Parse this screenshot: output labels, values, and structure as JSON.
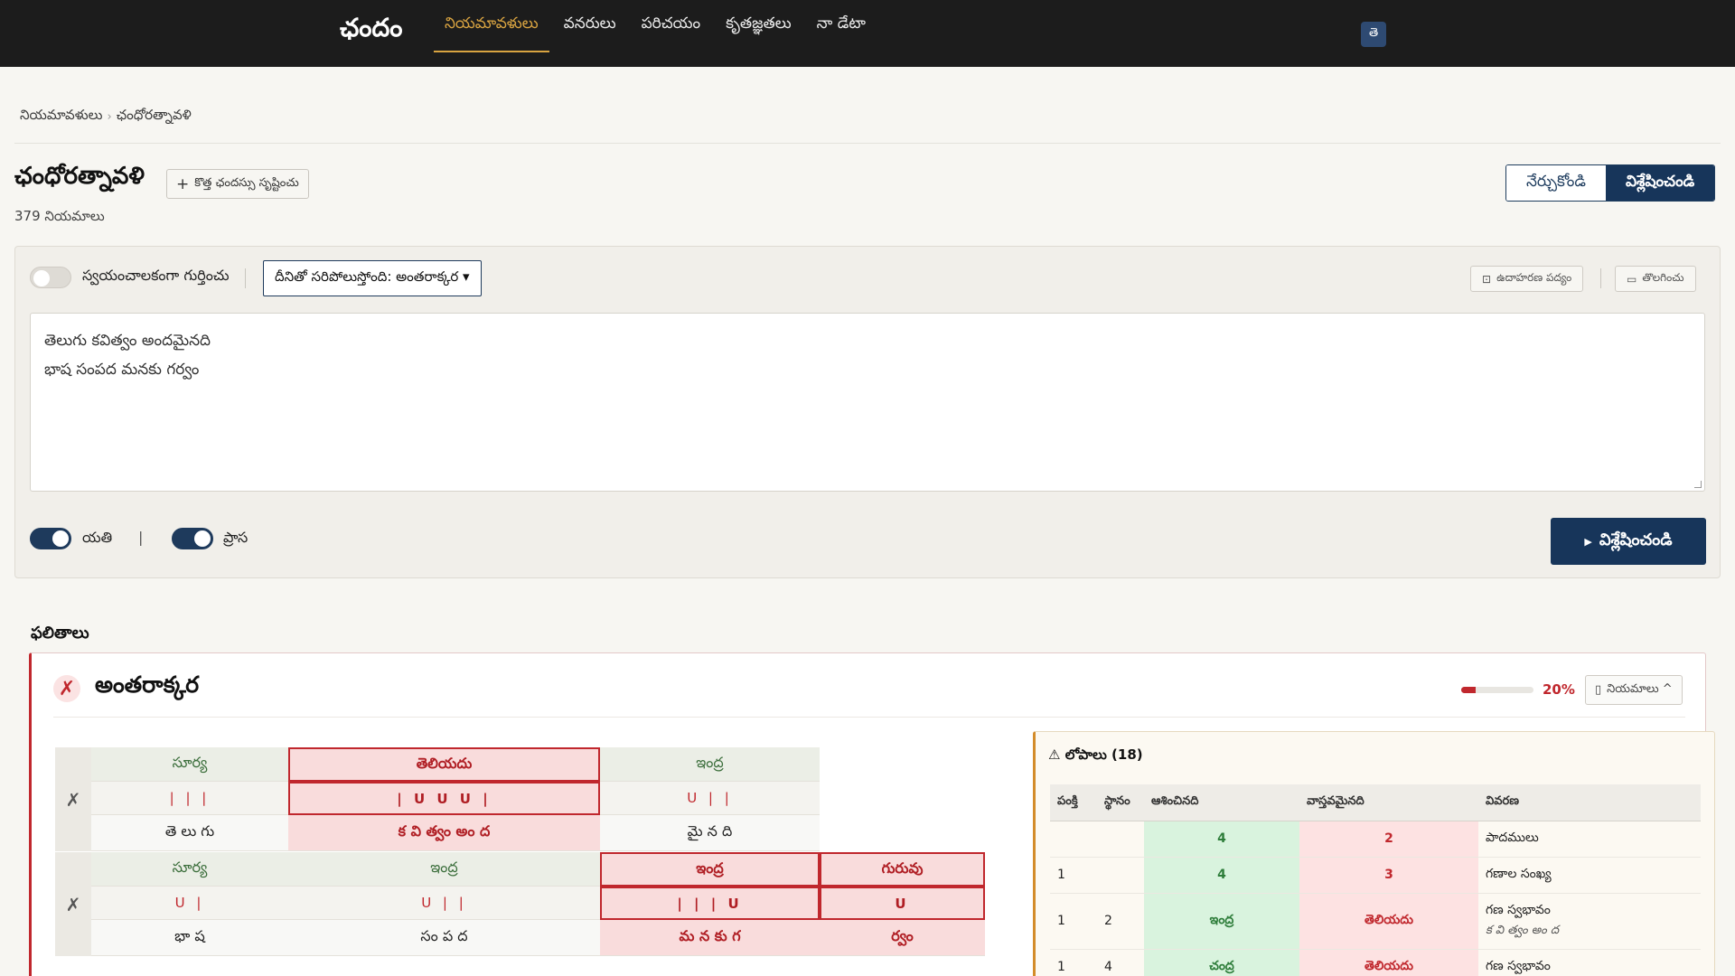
{
  "app": {
    "brand": "ఛందం",
    "lang_button": "తె"
  },
  "nav": [
    {
      "label": "నియమావళులు",
      "active": true
    },
    {
      "label": "వనరులు",
      "active": false
    },
    {
      "label": "పరిచయం",
      "active": false
    },
    {
      "label": "కృతజ్ఞతలు",
      "active": false
    },
    {
      "label": "నా డేటా",
      "active": false
    }
  ],
  "breadcrumb": [
    "నియమావళులు",
    "ఛంధోరత్నావళి"
  ],
  "page": {
    "title": "ఛంధోరత్నావళి",
    "new_button": "కొత్త ఛందస్సు సృష్టించు",
    "count": "379 నియమాలు",
    "mode_learn": "నేర్చుకోండి",
    "mode_analyze": "విశ్లేషించండి"
  },
  "analyzer": {
    "auto_detect_label": "స్వయంచాలకంగా గుర్తించు",
    "auto_detect_on": false,
    "meter_select": "దీనితో సరిపోలుస్తోంది: అంతరాక్కర ▾",
    "example_button": "ఉదాహరణ పద్యం",
    "clear_button": "తొలగించు",
    "poem_lines": [
      "తెలుగు కవిత్వం అందమైనది",
      "భాష సంపద మనకు గర్వం"
    ],
    "yati_label": "యతి",
    "yati_on": true,
    "prasa_label": "ప్రాస",
    "prasa_on": true,
    "analyze_button": "విశ్లేషించండి"
  },
  "results": {
    "heading": "ఫలితాలు",
    "meter_name": "అంతరాక్కర",
    "match_percent": 20,
    "match_label": "20%",
    "rules_button": "నియమాలు ^",
    "status_icon": "cross-icon",
    "rows": [
      {
        "mark": "✗",
        "cells": [
          {
            "gana": "సూర్య",
            "pattern": "| | |",
            "syllables": "తె లు గు",
            "bad": false
          },
          {
            "gana": "తెలియదు",
            "pattern": "| U U U |",
            "syllables": "క వి త్వం అం ద",
            "bad": true
          },
          {
            "gana": "ఇంద్ర",
            "pattern": "U | |",
            "syllables": "మై న ది",
            "bad": false
          }
        ]
      },
      {
        "mark": "✗",
        "cells": [
          {
            "gana": "సూర్య",
            "pattern": "U |",
            "syllables": "భా ష",
            "bad": false
          },
          {
            "gana": "ఇంద్ర",
            "pattern": "U | |",
            "syllables": "సం ప ద",
            "bad": false
          },
          {
            "gana": "ఇంద్ర",
            "pattern": "| | | U",
            "syllables": "మ న కు గ",
            "bad": true
          },
          {
            "gana": "గురువు",
            "pattern": "U",
            "syllables": "ర్వం",
            "bad": true
          }
        ]
      }
    ],
    "errors": {
      "title": "లోపాలు (18)",
      "warning_icon": "warning-icon",
      "columns": [
        "పంక్తి",
        "స్థానం",
        "ఆశించినది",
        "వాస్తవమైనది",
        "వివరణ"
      ],
      "rows": [
        {
          "line": "",
          "pos": "",
          "expected": "4",
          "actual": "2",
          "desc": "పాదములు",
          "sub": ""
        },
        {
          "line": "1",
          "pos": "",
          "expected": "4",
          "actual": "3",
          "desc": "గణాల సంఖ్య",
          "sub": ""
        },
        {
          "line": "1",
          "pos": "2",
          "expected": "ఇంద్ర",
          "actual": "తెలియదు",
          "desc": "గణ స్వభావం",
          "sub": "క వి త్వం అం ద"
        },
        {
          "line": "1",
          "pos": "4",
          "expected": "చంద్ర",
          "actual": "తెలియదు",
          "desc": "గణ స్వభావం",
          "sub": ""
        }
      ]
    }
  }
}
